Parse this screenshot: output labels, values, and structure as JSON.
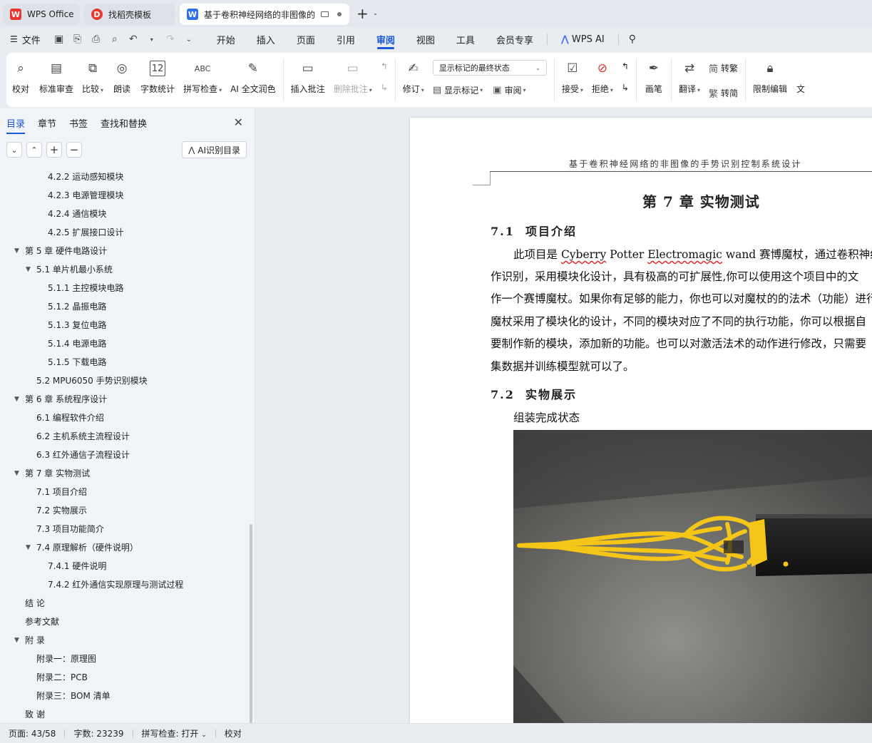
{
  "tabs": [
    {
      "label": "WPS Office",
      "icon": "wps-logo-icon"
    },
    {
      "label": "找稻壳模板",
      "icon": "docer-icon"
    },
    {
      "label": "基于卷积神经网络的非图像的",
      "icon": "word-doc-icon"
    }
  ],
  "menu": {
    "file": "文件",
    "tabs": [
      "开始",
      "插入",
      "页面",
      "引用",
      "审阅",
      "视图",
      "工具",
      "会员专享"
    ],
    "active_tab": "审阅",
    "wps_ai": "WPS AI"
  },
  "ribbon": {
    "proofread": "校对",
    "std_review": "标准审查",
    "compare": "比较",
    "read_aloud": "朗读",
    "word_count": "字数统计",
    "spell_check": "拼写检查",
    "ai_polish": "AI 全文润色",
    "insert_comment": "插入批注",
    "delete_comment": "删除批注",
    "track_changes": "修订",
    "markup_select": "显示标记的最终状态",
    "show_markup": "显示标记",
    "review_pane": "审阅",
    "accept": "接受",
    "reject": "拒绝",
    "pen": "画笔",
    "translate": "翻译",
    "to_simplified": "转繁",
    "to_traditional": "转简",
    "restrict_edit": "限制编辑",
    "word_count_icon_text": "12",
    "spell_icon_text": "ABC",
    "simp_glyph": "简",
    "trad_glyph": "繁",
    "cut_off": "文"
  },
  "nav": {
    "tabs": [
      "目录",
      "章节",
      "书签",
      "查找和替换"
    ],
    "ai_toc": "AI识别目录",
    "toc": [
      {
        "text": "4.2.2  运动感知模块",
        "level": 3,
        "arrow": false
      },
      {
        "text": "4.2.3  电源管理模块",
        "level": 3,
        "arrow": false
      },
      {
        "text": "4.2.4  通信模块",
        "level": 3,
        "arrow": false
      },
      {
        "text": "4.2.5  扩展接口设计",
        "level": 3,
        "arrow": false
      },
      {
        "text": "第 5 章  硬件电路设计",
        "level": 1,
        "arrow": true
      },
      {
        "text": "5.1 单片机最小系统",
        "level": 2,
        "arrow": true
      },
      {
        "text": "5.1.1 主控模块电路",
        "level": 3,
        "arrow": false
      },
      {
        "text": "5.1.2  晶振电路",
        "level": 3,
        "arrow": false
      },
      {
        "text": "5.1.3  复位电路",
        "level": 3,
        "arrow": false
      },
      {
        "text": "5.1.4  电源电路",
        "level": 3,
        "arrow": false
      },
      {
        "text": "5.1.5 下载电路",
        "level": 3,
        "arrow": false
      },
      {
        "text": "5.2 MPU6050 手势识别模块",
        "level": 2,
        "arrow": false
      },
      {
        "text": "第 6 章  系统程序设计",
        "level": 1,
        "arrow": true
      },
      {
        "text": "6.1  编程软件介绍",
        "level": 2,
        "arrow": false
      },
      {
        "text": "6.2  主机系统主流程设计",
        "level": 2,
        "arrow": false
      },
      {
        "text": "6.3  红外通信子流程设计",
        "level": 2,
        "arrow": false
      },
      {
        "text": "第 7 章  实物测试",
        "level": 1,
        "arrow": true
      },
      {
        "text": "7.1  项目介绍",
        "level": 2,
        "arrow": false
      },
      {
        "text": "7.2  实物展示",
        "level": 2,
        "arrow": false
      },
      {
        "text": "7.3  项目功能简介",
        "level": 2,
        "arrow": false
      },
      {
        "text": "7.4  原理解析（硬件说明）",
        "level": 2,
        "arrow": true
      },
      {
        "text": "7.4.1 硬件说明",
        "level": 3,
        "arrow": false
      },
      {
        "text": "7.4.2 红外通信实现原理与测试过程",
        "level": 3,
        "arrow": false
      },
      {
        "text": "结    论",
        "level": 1,
        "arrow": false
      },
      {
        "text": "参考文献",
        "level": 1,
        "arrow": false
      },
      {
        "text": "附    录",
        "level": 1,
        "arrow": true
      },
      {
        "text": "附录一：原理图",
        "level": 2,
        "arrow": false
      },
      {
        "text": "附录二：PCB",
        "level": 2,
        "arrow": false
      },
      {
        "text": "附录三：BOM 清单",
        "level": 2,
        "arrow": false
      },
      {
        "text": "致    谢",
        "level": 1,
        "arrow": false
      }
    ]
  },
  "doc": {
    "header": "基于卷积神经网络的非图像的手势识别控制系统设计",
    "chapter_title": "第 7 章  实物测试",
    "sec1_num": "7.1",
    "sec1_title": "项目介绍",
    "p1_pre": "此项目是 ",
    "p1_w1": "Cyberry",
    "p1_mid1": " Potter ",
    "p1_w2": "Electromagic",
    "p1_mid2": " ",
    "p1_w3": "wand",
    "p1_post": " 赛博魔杖，通过卷积神经网络",
    "p2": "作识别，采用模块化设计，具有极高的可扩展性,你可以使用这个项目中的文",
    "p3": "作一个赛博魔杖。如果你有足够的能力，你也可以对魔杖的的法术（功能）进行",
    "p4": "魔杖采用了模块化的设计，不同的模块对应了不同的执行功能，你可以根据自",
    "p5": "要制作新的模块，添加新的功能。也可以对激活法术的动作进行修改，只需要",
    "p6": "集数据并训练模型就可以了。",
    "sec2_num": "7.2",
    "sec2_title": "实物展示",
    "caption": "组装完成状态"
  },
  "status": {
    "page": "页面: 43/58",
    "words": "字数: 23239",
    "spell": "拼写检查: 打开",
    "proof": "校对"
  },
  "colors": {
    "accent": "#1a56d6",
    "wps_red": "#e8372f",
    "wand_yellow": "#f5c518"
  }
}
